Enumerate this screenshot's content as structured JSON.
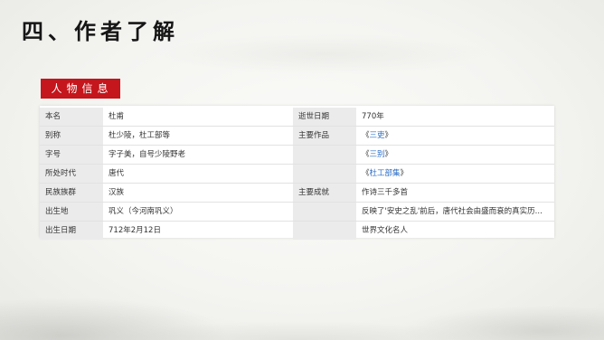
{
  "slide": {
    "title": "四、作者了解",
    "section_header": "人物信息"
  },
  "info_table": {
    "rows": [
      {
        "label1": "本名",
        "value1": "杜甫",
        "label2": "逝世日期",
        "value2": "770年"
      },
      {
        "label1": "别称",
        "value1": "杜少陵，杜工部等",
        "label2": "主要作品",
        "value2_prefix": "《",
        "value2_link": "三吏",
        "value2_suffix": "》"
      },
      {
        "label1": "字号",
        "value1": "字子美，自号少陵野老",
        "label2": "",
        "value2_prefix": "《",
        "value2_link": "三别",
        "value2_suffix": "》"
      },
      {
        "label1": "所处时代",
        "value1": "唐代",
        "label2": "",
        "value2_prefix": "《",
        "value2_link": "杜工部集",
        "value2_suffix": "》"
      },
      {
        "label1": "民族族群",
        "value1": "汉族",
        "label2": "主要成就",
        "value2": "作诗三千多首"
      },
      {
        "label1": "出生地",
        "value1": "巩义（今河南巩义）",
        "label2": "",
        "value2": "反映了'安史之乱'前后，唐代社会由盛而衰的真实历..."
      },
      {
        "label1": "出生日期",
        "value1": "712年2月12日",
        "label2": "",
        "value2": "世界文化名人"
      }
    ]
  },
  "colors": {
    "header_red": "#c4161c",
    "link_blue": "#2a6cc6",
    "label_bg": "#ebebeb"
  }
}
